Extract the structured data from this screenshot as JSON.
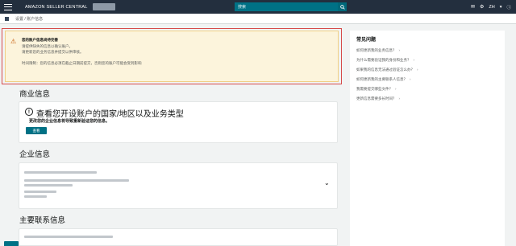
{
  "topbar": {
    "brand": "AMAZON SELLER CENTRAL",
    "search_placeholder": "搜索",
    "language": "ZH"
  },
  "breadcrumb": "设置   /   账户信息",
  "alert": {
    "title": "您的账户信息尚待完善",
    "line1": "请提供缺失的信息以确认账户。",
    "line2": "请更新您的业务信息并提交以供审核。",
    "line3": "时间限制：您的信息必须在截止日期前提交，否则您的账户可能会受到影响"
  },
  "sidebar": {
    "title": "常见问题",
    "links": [
      "如何更新我的业务信息？",
      "为什么需要验证我的身份和业务？",
      "如果我的信息无法通过验证怎么办？",
      "如何更新我的主要联系人信息？",
      "我需要提交哪些文件？",
      "更新信息需要多长时间？"
    ]
  },
  "business_info": {
    "heading": "商业信息",
    "card_title": "查看您开设账户的国家/地区以及业务类型",
    "card_sub": "更改您的企业信息将导致重新验证您的信息。",
    "button": "查看"
  },
  "company_info": {
    "heading": "企业信息"
  },
  "contact_info": {
    "heading": "主要联系信息"
  }
}
